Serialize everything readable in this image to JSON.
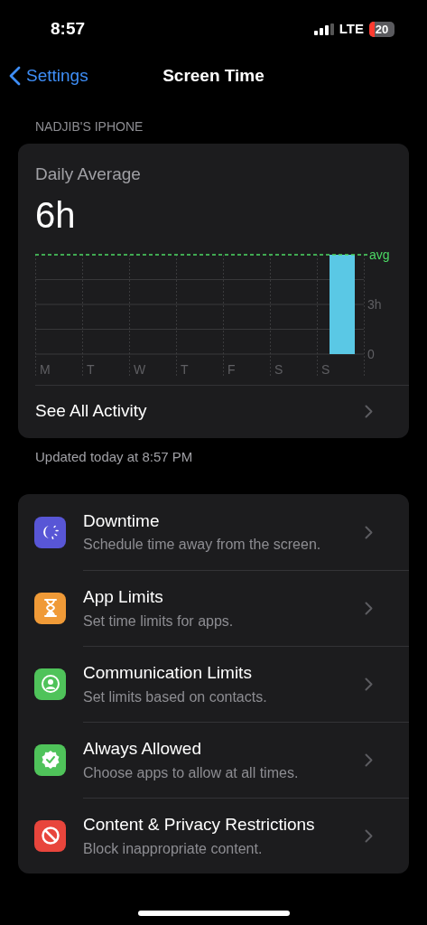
{
  "status_bar": {
    "time": "8:57",
    "network": "LTE",
    "battery": "20"
  },
  "nav": {
    "back": "Settings",
    "title": "Screen Time"
  },
  "device_header": "NADJIB'S IPHONE",
  "summary": {
    "label": "Daily Average",
    "value": "6h",
    "chart_data": {
      "type": "bar",
      "categories": [
        "M",
        "T",
        "W",
        "T",
        "F",
        "S",
        "S"
      ],
      "series": [
        {
          "color": "#5ac8e5",
          "values": [
            0,
            0,
            0,
            0,
            0,
            0,
            6
          ]
        }
      ],
      "ylim": [
        0,
        6
      ],
      "yticks": [
        {
          "value": 0,
          "label": "0"
        },
        {
          "value": 3,
          "label": "3h"
        },
        {
          "value": 6,
          "label": "avg"
        }
      ]
    },
    "link": "See All Activity"
  },
  "updated": "Updated today at 8:57 PM",
  "items": [
    {
      "kind": "downtime",
      "color": "#5856d6",
      "title": "Downtime",
      "subtitle": "Schedule time away from the screen."
    },
    {
      "kind": "app-limits",
      "color": "#f09a37",
      "title": "App Limits",
      "subtitle": "Set time limits for apps."
    },
    {
      "kind": "communication",
      "color": "#4fc35a",
      "title": "Communication Limits",
      "subtitle": "Set limits based on contacts."
    },
    {
      "kind": "allowed",
      "color": "#4fc35a",
      "title": "Always Allowed",
      "subtitle": "Choose apps to allow at all times."
    },
    {
      "kind": "restrictions",
      "color": "#e8453c",
      "title": "Content & Privacy Restrictions",
      "subtitle": "Block inappropriate content."
    }
  ]
}
